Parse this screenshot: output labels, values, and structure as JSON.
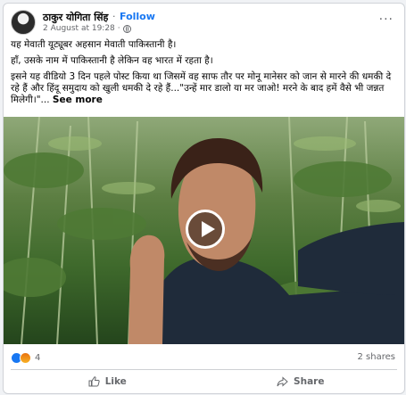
{
  "post": {
    "author": "ठाकुर योगिता सिंह",
    "follow_label": "Follow",
    "timestamp": "2 August at 19:28",
    "separator": "·",
    "more_label": "···",
    "text": {
      "line1": "यह मेवाती यूट्यूबर अहसान मेवाती पाकिस्तानी है।",
      "line2": "हाँ, उसके नाम में पाकिस्तानी है लेकिन वह भारत में रहता है।",
      "line3": "इसने यह वीडियो 3 दिन पहले पोस्ट किया था जिसमें वह साफ तौर पर मोनू मानेसर को जान से मारने की धमकी दे रहे हैं और हिंदू समुदाय को खुली धमकी दे रहे हैं...\"उन्हें मार डालो या मर जाओ! मरने के बाद हमें वैसे भी जन्नत मिलेगी।\"...",
      "see_more": "See more"
    }
  },
  "stats": {
    "reaction_count": "4",
    "shares": "2 shares"
  },
  "actions": {
    "like": "Like",
    "share": "Share"
  },
  "colors": {
    "accent": "#1877f2",
    "secondary_text": "#65676b"
  }
}
